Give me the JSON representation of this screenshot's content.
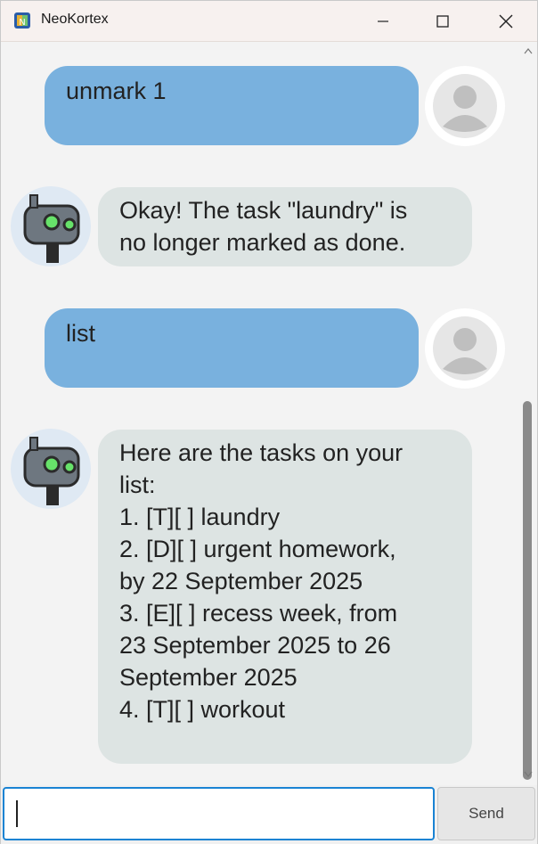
{
  "window": {
    "title": "NeoKortex"
  },
  "messages": [
    {
      "sender": "user",
      "text": "unmark 1"
    },
    {
      "sender": "bot",
      "text": "Okay! The task \"laundry\" is\nno longer marked as done."
    },
    {
      "sender": "user",
      "text": "list"
    },
    {
      "sender": "bot",
      "text": "Here are the tasks on your\nlist:\n1. [T][ ] laundry\n2. [D][ ] urgent homework,\nby 22 September 2025\n3. [E][ ] recess week, from\n23 September 2025 to 26\nSeptember 2025\n4. [T][ ] workout"
    }
  ],
  "input": {
    "value": "",
    "placeholder": ""
  },
  "send_label": "Send",
  "colors": {
    "user_bubble": "#79b1de",
    "bot_bubble": "#dde4e3",
    "input_focus": "#1a83d3"
  }
}
